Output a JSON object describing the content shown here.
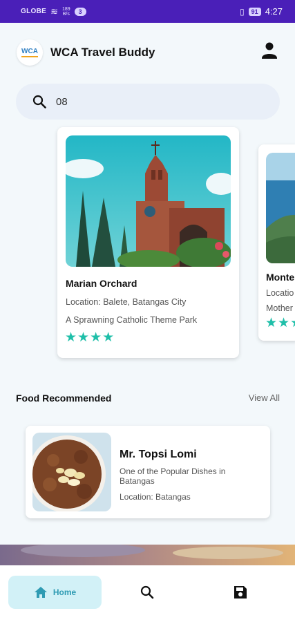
{
  "status_bar": {
    "carrier": "GLOBE",
    "net_speed_top": "189",
    "net_speed_bottom": "B/s",
    "notification_count": "3",
    "battery": "91",
    "time": "4:27"
  },
  "header": {
    "logo_text": "WCA",
    "title": "WCA Travel Buddy",
    "profile_icon": "person-icon"
  },
  "search": {
    "value": "08",
    "icon": "search-icon"
  },
  "places": [
    {
      "name": "Marian Orchard",
      "location": "Location: Balete, Batangas City",
      "description": "A Sprawning Catholic Theme Park",
      "rating": 4,
      "stars": "★★★★"
    },
    {
      "name": "Monte",
      "location": "Locatio",
      "description": "Mother",
      "rating": 3,
      "stars": "★★★"
    }
  ],
  "food_section": {
    "title": "Food Recommended",
    "view_all": "View All"
  },
  "food": [
    {
      "name": "Mr. Topsi Lomi",
      "description": "One of the Popular Dishes in Batangas",
      "location": "Location: Batangas"
    }
  ],
  "bottom_nav": {
    "home_label": "Home",
    "items": [
      "home-icon",
      "search-icon",
      "save-icon"
    ]
  },
  "colors": {
    "status_bar": "#4a1fb8",
    "accent": "#1fbfa9",
    "nav_active_bg": "#d2f1f7",
    "nav_active_text": "#2f9bb3",
    "background": "#f3f8fb"
  }
}
